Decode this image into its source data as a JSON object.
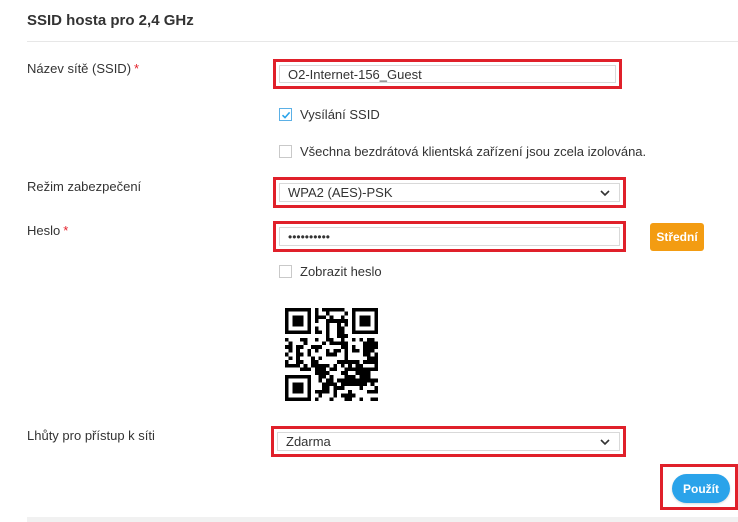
{
  "section": {
    "title": "SSID hosta pro 2,4 GHz"
  },
  "ssid": {
    "label": "Název sítě (SSID)",
    "required_mark": "*",
    "value": "O2-Internet-156_Guest"
  },
  "broadcast": {
    "label": "Vysílání SSID",
    "checked": true
  },
  "isolation": {
    "label": "Všechna bezdrátová klientská zařízení jsou zcela izolována.",
    "checked": false
  },
  "security": {
    "label": "Režim zabezpečení",
    "selected": "WPA2 (AES)-PSK"
  },
  "password": {
    "label": "Heslo",
    "required_mark": "*",
    "masked_value": "••••••••••",
    "strength": "Střední"
  },
  "show_password": {
    "label": "Zobrazit heslo",
    "checked": false
  },
  "access_time": {
    "label": "Lhůty pro přístup k síti",
    "selected": "Zdarma"
  },
  "actions": {
    "apply_label": "Použít"
  },
  "colors": {
    "highlight": "#e0202a",
    "accent": "#2aa3ea",
    "strength_badge": "#f39c12",
    "required": "#e4202a"
  },
  "icons": {
    "select_arrow": "chevron-down-icon",
    "check": "checkmark-icon",
    "qr": "qr-code-icon"
  }
}
